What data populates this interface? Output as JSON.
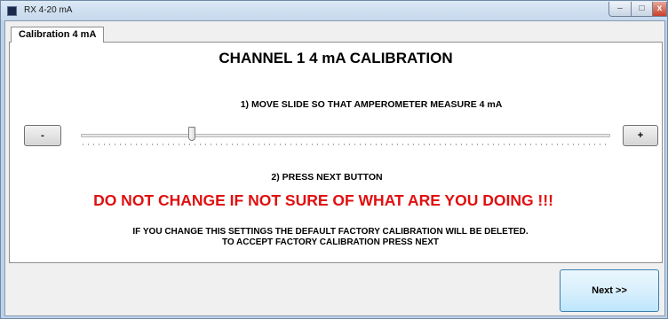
{
  "window": {
    "title": "RX 4-20 mA"
  },
  "tabs": [
    {
      "label": "Calibration 4 mA"
    }
  ],
  "calibration": {
    "heading": "CHANNEL 1 4 mA CALIBRATION",
    "step1": "1) MOVE SLIDE SO THAT AMPEROMETER MEASURE 4 mA",
    "step2": "2) PRESS NEXT BUTTON",
    "warning": "DO NOT CHANGE IF NOT SURE OF WHAT ARE YOU DOING !!!",
    "info_line1": "IF YOU CHANGE THIS SETTINGS THE DEFAULT FACTORY CALIBRATION WILL BE DELETED.",
    "info_line2": "TO ACCEPT FACTORY CALIBRATION PRESS NEXT",
    "minus_label": "-",
    "plus_label": "+",
    "slider_value": 0.205,
    "warning_color": "#e01010"
  },
  "footer": {
    "next_label": "Next >>"
  },
  "icons": [
    "app-icon",
    "minimize-icon",
    "maximize-icon",
    "close-icon"
  ]
}
